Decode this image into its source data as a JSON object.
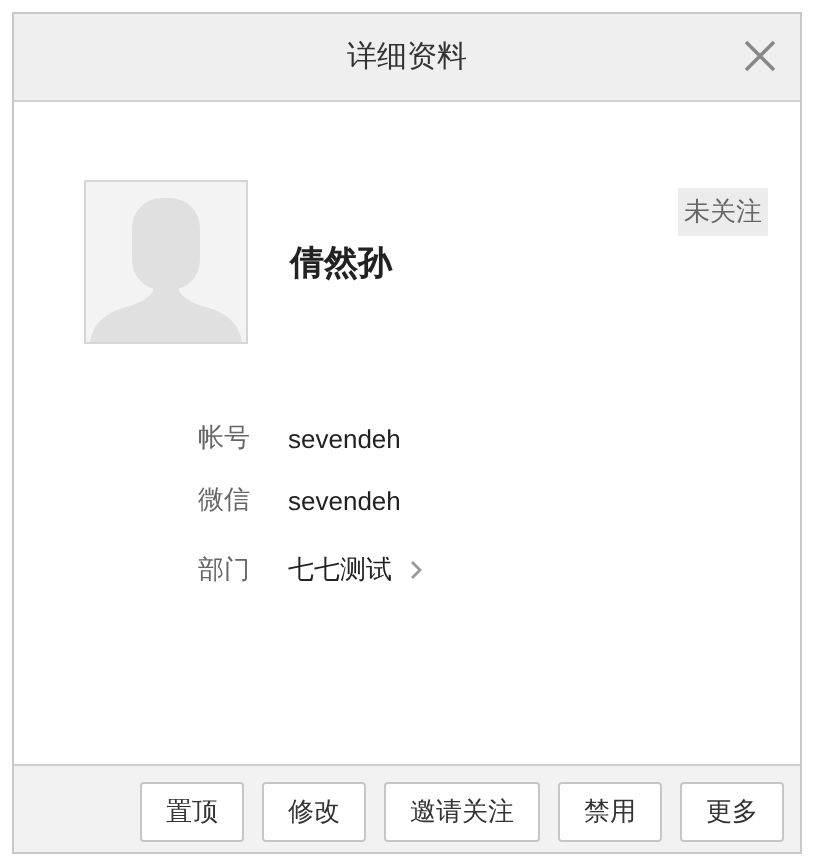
{
  "window": {
    "title": "详细资料"
  },
  "profile": {
    "name": "倩然孙",
    "follow_status": "未关注"
  },
  "fields": [
    {
      "label": "帐号",
      "value": "sevendeh",
      "kind": "text"
    },
    {
      "label": "微信",
      "value": "sevendeh",
      "kind": "text"
    },
    {
      "label": "部门",
      "value": "七七测试",
      "kind": "link"
    }
  ],
  "buttons": [
    "置顶",
    "修改",
    "邀请关注",
    "禁用",
    "更多"
  ]
}
